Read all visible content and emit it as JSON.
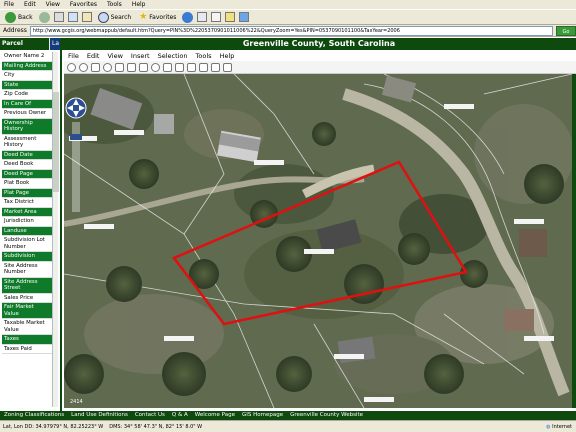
{
  "browser": {
    "menu": [
      "File",
      "Edit",
      "View",
      "Favorites",
      "Tools",
      "Help"
    ],
    "toolbar": {
      "back": "Back",
      "search": "Search",
      "favorites": "Favorites"
    },
    "address_label": "Address",
    "address_url": "http://www.gcgis.org/webmappub/default.htm?Query=PIN%3D%2205370901011006%22&QueryZoom=Yes&PIN=0537090101100&TaxYear=2006",
    "go": "Go"
  },
  "app": {
    "title": "Greenville County, South Carolina",
    "menu": [
      "File",
      "Edit",
      "View",
      "Insert",
      "Selection",
      "Tools",
      "Help"
    ],
    "tabs": {
      "parcel_search": "Parcel Search",
      "la": "La"
    }
  },
  "left_panel": {
    "items": [
      {
        "label": "Owner Name 2",
        "hl": false
      },
      {
        "label": "Mailing Address",
        "hl": true
      },
      {
        "label": "City",
        "hl": false
      },
      {
        "label": "State",
        "hl": true
      },
      {
        "label": "Zip Code",
        "hl": false
      },
      {
        "label": "In Care Of",
        "hl": true
      },
      {
        "label": "Previous Owner",
        "hl": false
      },
      {
        "label": "Ownership History",
        "hl": true
      },
      {
        "label": "Assessment History",
        "hl": false
      },
      {
        "label": "Deed Date",
        "hl": true
      },
      {
        "label": "Deed Book",
        "hl": false
      },
      {
        "label": "Deed Page",
        "hl": true
      },
      {
        "label": "Plat Book",
        "hl": false
      },
      {
        "label": "Plat Page",
        "hl": true
      },
      {
        "label": "Tax District",
        "hl": false
      },
      {
        "label": "Market Area",
        "hl": true
      },
      {
        "label": "Jurisdiction",
        "hl": false
      },
      {
        "label": "Landuse",
        "hl": true
      },
      {
        "label": "Subdivision Lot Number",
        "hl": false
      },
      {
        "label": "Subdivision",
        "hl": true
      },
      {
        "label": "Site Address Number",
        "hl": false
      },
      {
        "label": "Site Address Street",
        "hl": true
      },
      {
        "label": "Sales Price",
        "hl": false
      },
      {
        "label": "Fair Market Value",
        "hl": true
      },
      {
        "label": "Taxable Market Value",
        "hl": false
      },
      {
        "label": "Taxes",
        "hl": true
      },
      {
        "label": "Taxes Paid",
        "hl": false
      }
    ]
  },
  "bottom_links": [
    "Zoning Classifications",
    "Land Use Definitions",
    "Contact Us",
    "Q & A",
    "Welcome Page",
    "GIS Homepage",
    "Greenville County Website"
  ],
  "status": {
    "coords": "Lat, Lon DD: 34.97979° N, 82.25223° W",
    "dms": "DMS: 34° 58' 47.3\" N, 82° 15' 8.0\" W",
    "zone": "Internet"
  },
  "map": {
    "scale_label": "2414"
  }
}
